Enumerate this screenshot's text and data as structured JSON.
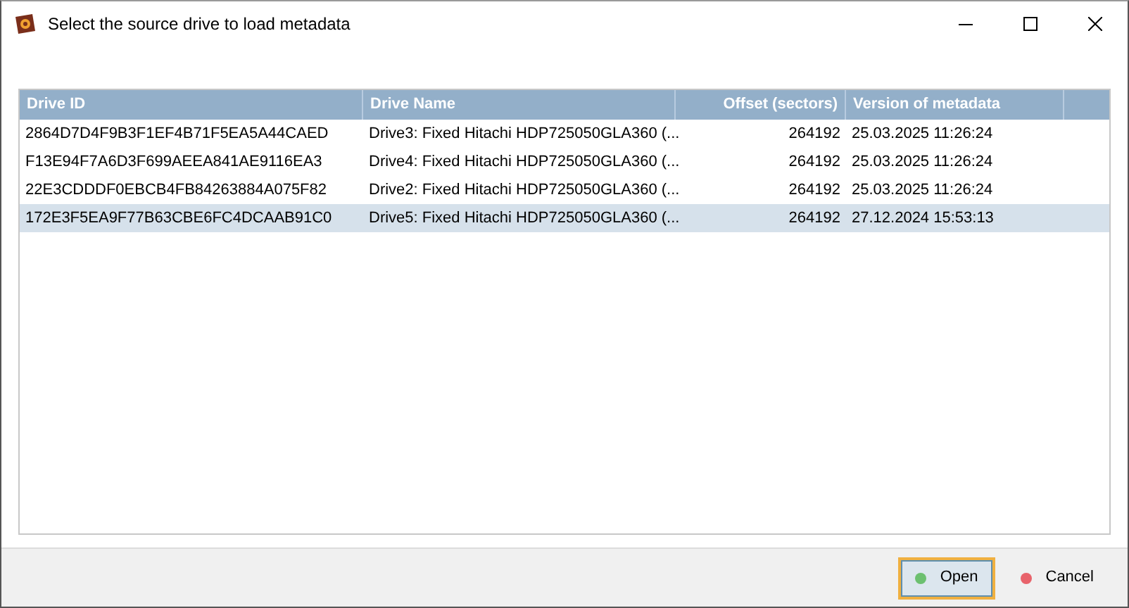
{
  "window": {
    "title": "Select the source drive to load metadata"
  },
  "table": {
    "columns": [
      "Drive ID",
      "Drive Name",
      "Offset (sectors)",
      "Version of metadata"
    ],
    "rows": [
      {
        "cells": [
          "2864D7D4F9B3F1EF4B71F5EA5A44CAED",
          "Drive3: Fixed Hitachi HDP725050GLA360 (...",
          "264192",
          "25.03.2025 11:26:24"
        ],
        "selected": false
      },
      {
        "cells": [
          "F13E94F7A6D3F699AEEA841AE9116EA3",
          "Drive4: Fixed Hitachi HDP725050GLA360 (...",
          "264192",
          "25.03.2025 11:26:24"
        ],
        "selected": false
      },
      {
        "cells": [
          "22E3CDDDF0EBCB4FB84263884A075F82",
          "Drive2: Fixed Hitachi HDP725050GLA360 (...",
          "264192",
          "25.03.2025 11:26:24"
        ],
        "selected": false
      },
      {
        "cells": [
          "172E3F5EA9F77B63CBE6FC4DCAAB91C0",
          "Drive5: Fixed Hitachi HDP725050GLA360 (...",
          "264192",
          "27.12.2024 15:53:13"
        ],
        "selected": true
      }
    ]
  },
  "buttons": [
    {
      "label": "Open",
      "color": "#6cc070",
      "focused": true
    },
    {
      "label": "Cancel",
      "color": "#e8636b",
      "focused": false
    }
  ]
}
